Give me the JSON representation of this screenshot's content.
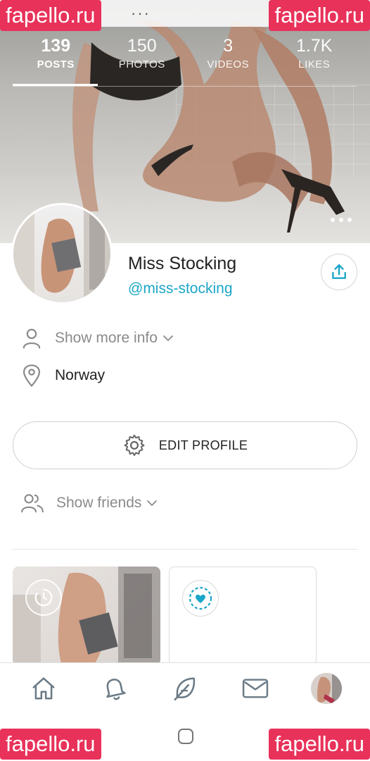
{
  "watermarks": {
    "top_left": "fapello.ru",
    "top_right": "fapello.ru",
    "bottom_left": "fapello.ru",
    "bottom_right": "fapello.ru",
    "color": "#e8325a"
  },
  "topbar": {
    "more_label": "···"
  },
  "stats": [
    {
      "value": "139",
      "label": "POSTS",
      "active": true
    },
    {
      "value": "150",
      "label": "PHOTOS",
      "active": false
    },
    {
      "value": "3",
      "label": "VIDEOS",
      "active": false
    },
    {
      "value": "1.7K",
      "label": "LIKES",
      "active": false
    }
  ],
  "profile": {
    "name": "Miss Stocking",
    "handle": "@miss-stocking",
    "show_more_info": "Show more info",
    "location": "Norway",
    "edit_profile": "EDIT PROFILE",
    "show_friends": "Show friends"
  },
  "colors": {
    "accent": "#1ba6c7",
    "text_muted": "#8a8a8a",
    "text": "#222222"
  },
  "icons": {
    "share": "share-icon",
    "person": "person-icon",
    "location": "location-pin-icon",
    "gear": "gear-icon",
    "friends": "friends-icon",
    "home": "home-icon",
    "bell": "bell-icon",
    "feather": "feather-icon",
    "mail": "mail-icon"
  }
}
